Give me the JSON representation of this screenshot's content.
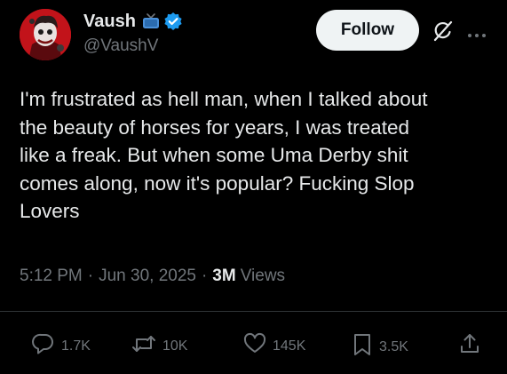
{
  "author": {
    "display_name": "Vaush",
    "handle": "@VaushV"
  },
  "header": {
    "follow_label": "Follow"
  },
  "post": {
    "text": "I'm frustrated as hell man, when I talked about\nthe beauty of horses for years, I was treated\nlike a freak. But when some Uma Derby shit\ncomes along, now it's popular? Fucking Slop\nLovers",
    "time": "5:12 PM",
    "date": "Jun 30, 2025",
    "separator": "·",
    "views_count": "3M",
    "views_label": "Views"
  },
  "actions": {
    "replies": "1.7K",
    "reposts": "10K",
    "likes": "145K",
    "bookmarks": "3.5K"
  },
  "icons": {
    "avatar": "avatar-image",
    "tv": "tv-icon",
    "verified": "verified-badge-icon",
    "grok": "grok-icon",
    "more": "more-icon",
    "reply": "reply-icon",
    "repost": "repost-icon",
    "like": "heart-icon",
    "bookmark": "bookmark-icon",
    "share": "share-icon"
  },
  "colors": {
    "background": "#000000",
    "text": "#e7e9ea",
    "muted": "#71767b",
    "verified": "#1d9bf0",
    "follow_bg": "#eff3f4",
    "divider": "#2f3336",
    "avatar_bg": "#c2131a"
  }
}
